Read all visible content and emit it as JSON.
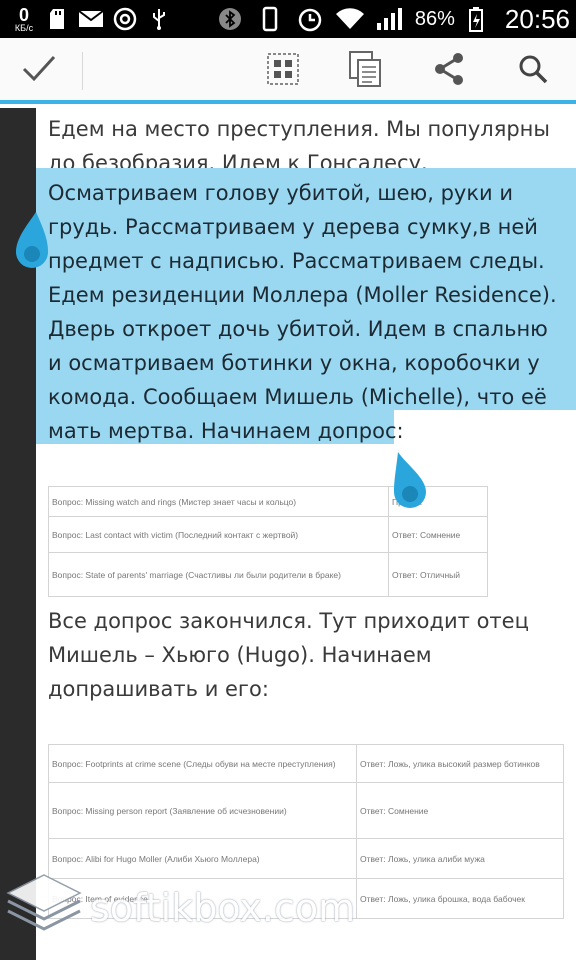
{
  "status_bar": {
    "net_speed": "0",
    "net_unit": "КБ/с",
    "battery_percent": "86%",
    "time": "20:56",
    "icons": [
      "sd-card-icon",
      "mail-icon",
      "at-icon",
      "usb-icon",
      "bluetooth-icon",
      "vibrate-icon",
      "alarm-icon",
      "wifi-icon",
      "signal-icon",
      "battery-icon"
    ]
  },
  "toolbar": {
    "icons": [
      "check-icon",
      "select-all-icon",
      "copy-icon",
      "share-icon",
      "search-icon"
    ]
  },
  "document": {
    "para1": "Едем на место преступления. Мы популярны до безобразия. Идем к Гонсалесу.",
    "para_selected": "Осматриваем голову убитой, шею, руки и грудь. Рассматриваем у дерева сумку,в ней предмет с надписью. Рассматриваем следы. Едем резиденции Моллера (Moller Residence). Дверь откроет дочь убитой. Идем в спальню и осматриваем ботинки у окна, коробочки у комода. Сообщаем Мишель (Michelle), что её мать мертва. Начинаем допрос:",
    "table1": [
      [
        "Вопрос: Missing watch and rings (Мистер знает часы и кольцо)",
        "Правда"
      ],
      [
        "Вопрос: Last contact with victim (Последний контакт с жертвой)",
        "Ответ: Сомнение"
      ],
      [
        "Вопрос: State of parents' marriage (Счастливы ли были родители в браке)",
        "Ответ: Отличный"
      ]
    ],
    "para2": "Все допрос закончился. Тут приходит отец Мишель – Хьюго (Hugo). Начинаем допрашивать и его:",
    "table2": [
      [
        "Вопрос: Footprints at crime scene (Следы обуви на месте преступления)",
        "Ответ: Ложь, улика высокий размер ботинков"
      ],
      [
        "Вопрос: Missing person report (Заявление об исчезновении)",
        "Ответ: Сомнение"
      ],
      [
        "Вопрос: Alibi for Hugo Moller (Алиби Хьюго Моллера)",
        "Ответ: Ложь, улика алиби мужа"
      ],
      [
        "Вопрос: Item of evidence",
        "Ответ: Ложь, улика брошка, вода бабочек"
      ]
    ]
  },
  "watermark": {
    "text": "softikbox.com"
  }
}
